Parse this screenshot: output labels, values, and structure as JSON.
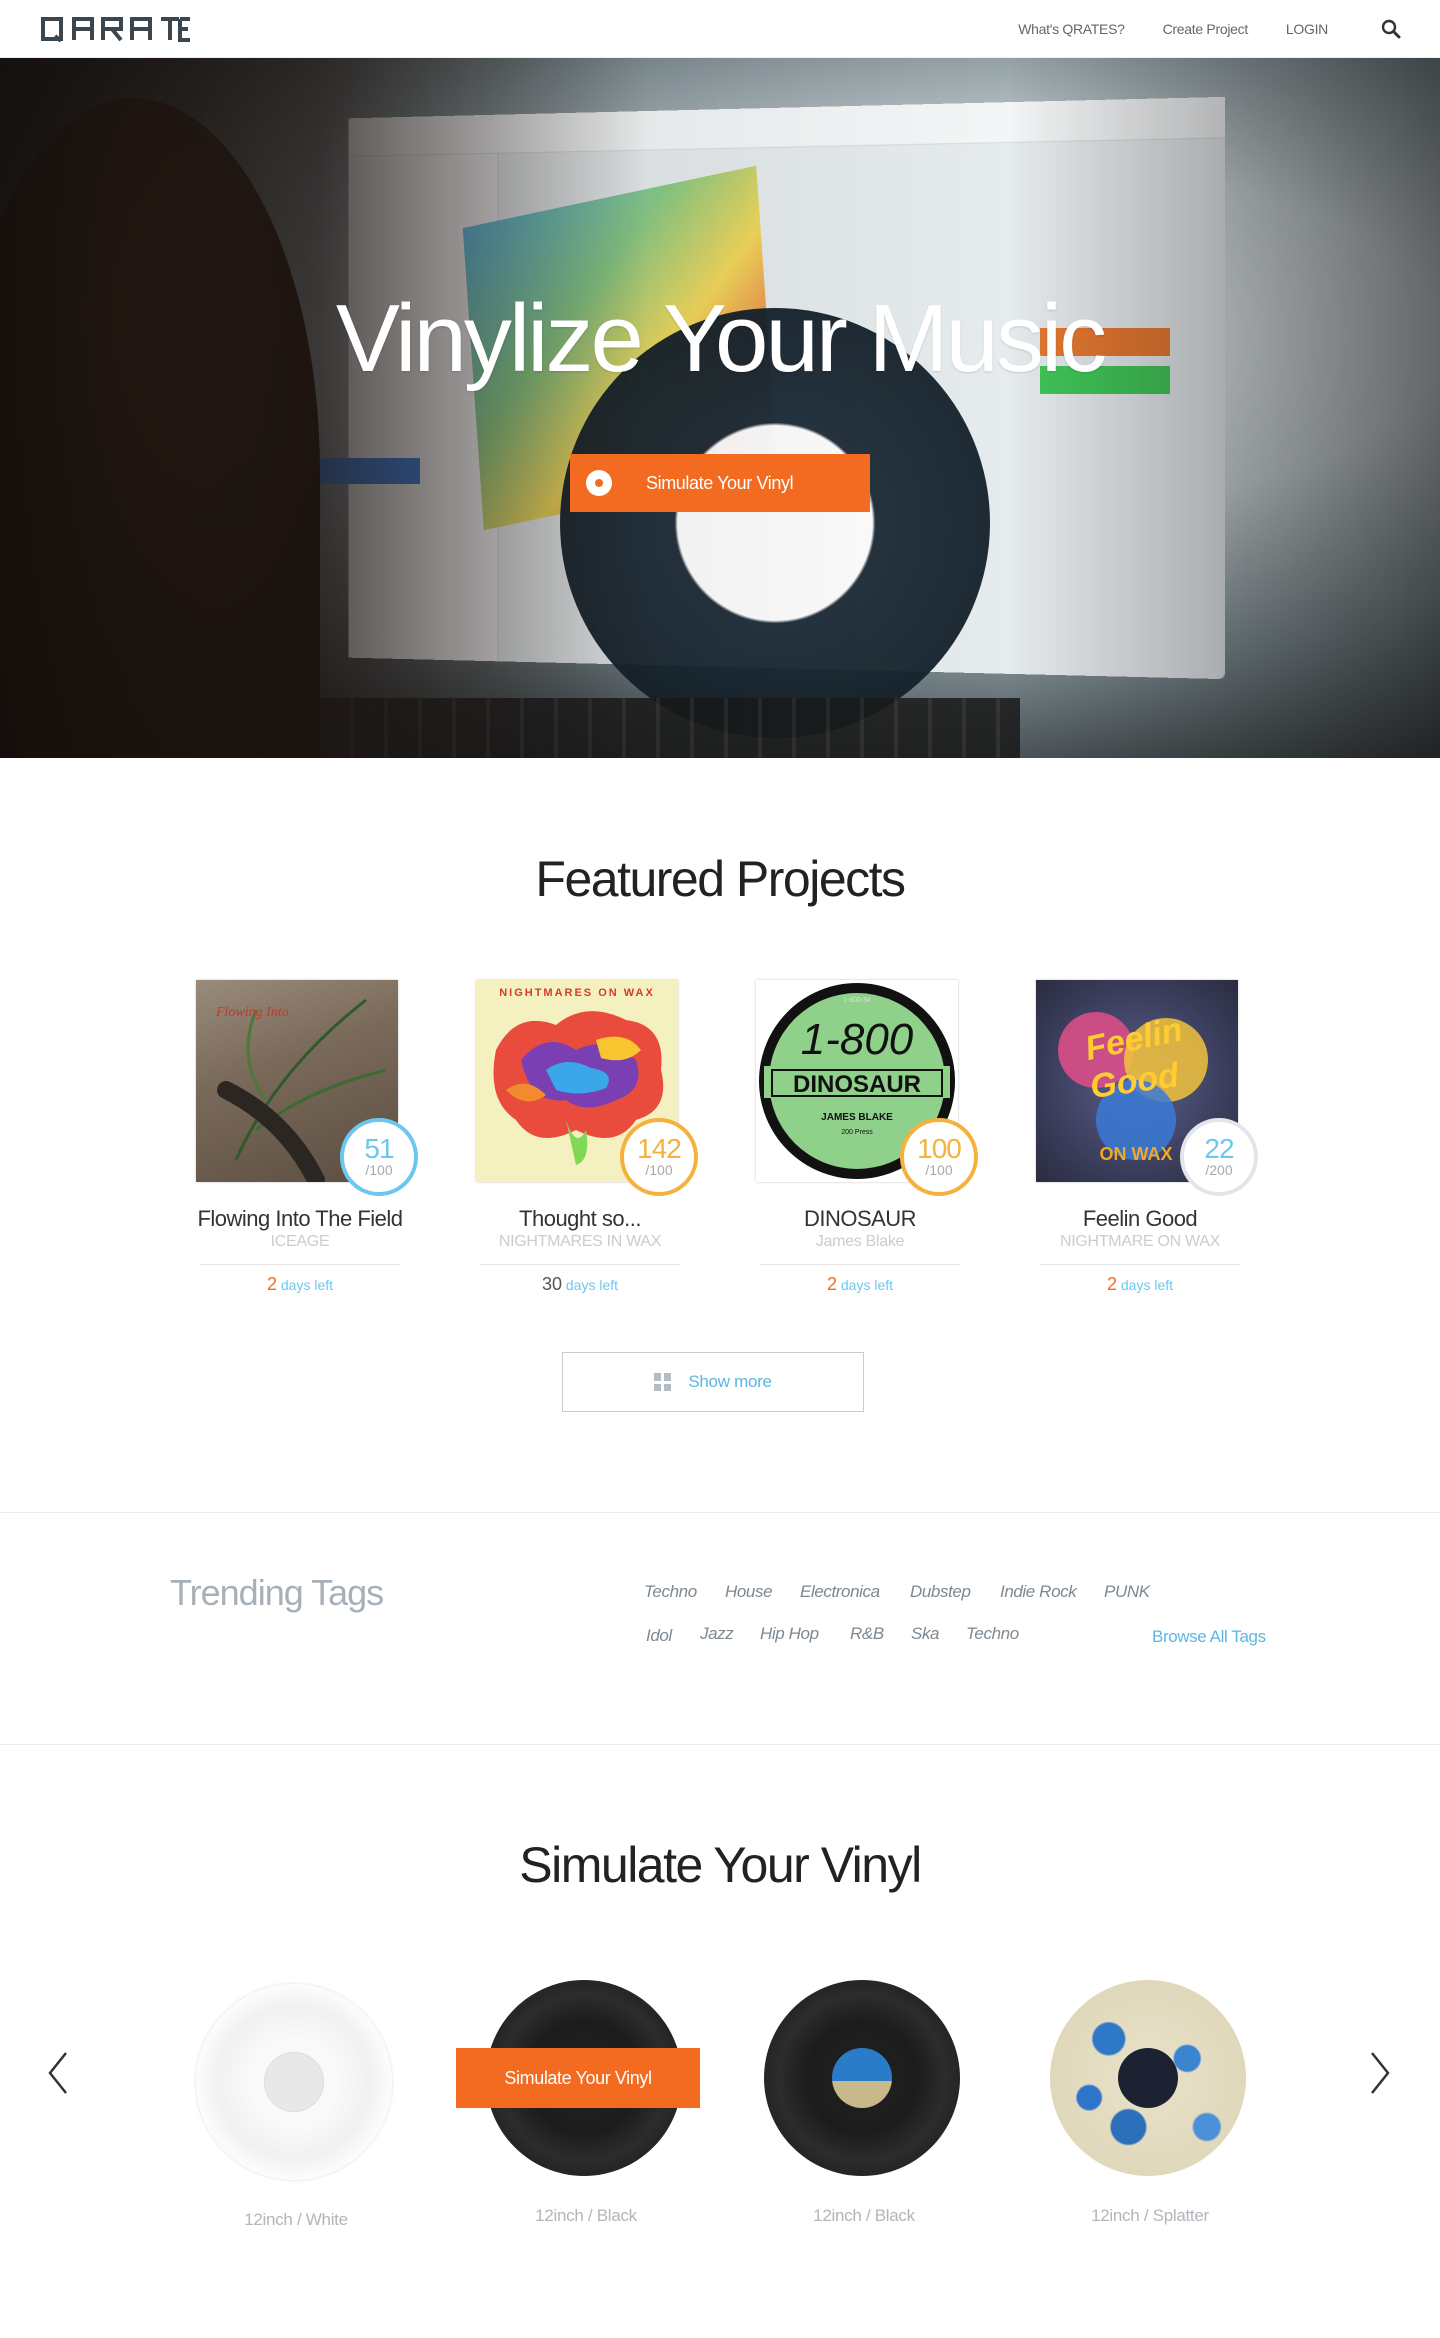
{
  "header": {
    "logo_text": "QRATES",
    "nav": [
      "What's QRATES?",
      "Create Project",
      "LOGIN"
    ],
    "search_icon": "search-icon"
  },
  "hero": {
    "title": "Vinylize Your Music",
    "cta_label": "Simulate Your Vinyl",
    "cta_color": "#f26b20"
  },
  "featured": {
    "title": "Featured Projects",
    "projects": [
      {
        "title": "Flowing Into The Field",
        "artist": "ICEAGE",
        "count": "51",
        "total": "/100",
        "days": "2",
        "days_label": "days left",
        "ring_color": "#6cc7ef",
        "days_color": "#f26b20"
      },
      {
        "title": "Thought so...",
        "artist": "NIGHTMARES IN WAX",
        "count": "142",
        "total": "/100",
        "days": "30",
        "days_label": "days left",
        "ring_color": "#f5b13d",
        "days_color": "#555555"
      },
      {
        "title": "DINOSAUR",
        "artist": "James Blake",
        "count": "100",
        "total": "/100",
        "days": "2",
        "days_label": "days left",
        "ring_color": "#f5b13d",
        "days_color": "#f26b20"
      },
      {
        "title": "Feelin Good",
        "artist": "NIGHTMARE ON WAX",
        "count": "22",
        "total": "/200",
        "days": "2",
        "days_label": "days left",
        "ring_color": "#e3e6e9",
        "days_color": "#f26b20"
      }
    ],
    "show_more": "Show more"
  },
  "trending": {
    "title": "Trending Tags",
    "tags_row1": [
      "Techno",
      "House",
      "Electronica",
      "Dubstep",
      "Indie Rock",
      "PUNK"
    ],
    "tags_row2": [
      "Idol",
      "Jazz",
      "Hip Hop",
      "R&B",
      "Ska",
      "Techno"
    ],
    "browse_all": "Browse All Tags"
  },
  "simulate": {
    "title": "Simulate Your Vinyl",
    "button": "Simulate Your Vinyl",
    "vinyls": [
      {
        "caption": "12inch / White"
      },
      {
        "caption": "12inch / Black"
      },
      {
        "caption": "12inch / Black"
      },
      {
        "caption": "12inch / Splatter"
      }
    ]
  }
}
